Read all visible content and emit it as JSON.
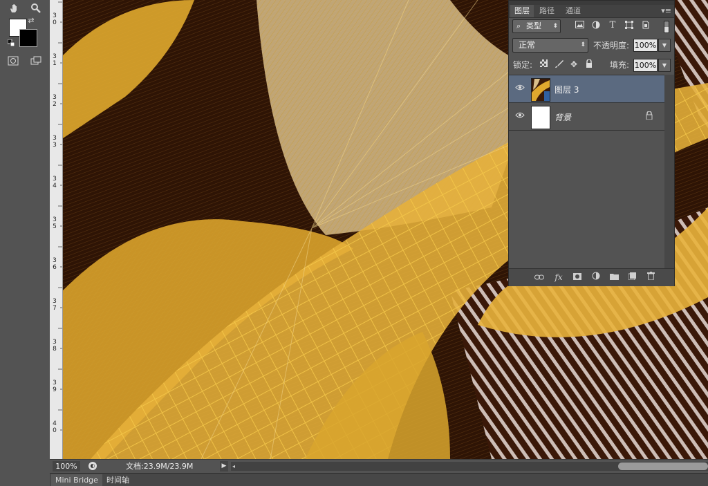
{
  "toolbar": {
    "tools": [
      "hand-icon",
      "zoom-icon",
      "swap-colors-icon",
      "default-colors-icon",
      "quick-mask-icon",
      "screen-mode-icon"
    ]
  },
  "ruler": {
    "labels": [
      {
        "digits": [
          "3",
          "0"
        ]
      },
      {
        "digits": [
          "3",
          "1"
        ]
      },
      {
        "digits": [
          "3",
          "2"
        ]
      },
      {
        "digits": [
          "3",
          "3"
        ]
      },
      {
        "digits": [
          "3",
          "4"
        ]
      },
      {
        "digits": [
          "3",
          "5"
        ]
      },
      {
        "digits": [
          "3",
          "6"
        ]
      },
      {
        "digits": [
          "3",
          "7"
        ]
      },
      {
        "digits": [
          "3",
          "8"
        ]
      },
      {
        "digits": [
          "3",
          "9"
        ]
      },
      {
        "digits": [
          "4",
          "0"
        ]
      }
    ]
  },
  "status": {
    "zoom": "100%",
    "doc_info": "文档:23.9M/23.9M"
  },
  "bottom_tabs": [
    "Mini Bridge",
    "时间轴"
  ],
  "layers_panel": {
    "tabs": [
      "图层",
      "路径",
      "通道"
    ],
    "active_tab": "图层",
    "filter": "类型",
    "blend_mode": "正常",
    "opacity_label": "不透明度:",
    "opacity": "100%",
    "lock_label": "锁定:",
    "fill_label": "填充:",
    "fill": "100%",
    "layers": [
      {
        "name": "图层 3",
        "selected": true,
        "locked": false
      },
      {
        "name": "背景",
        "selected": false,
        "locked": true
      }
    ]
  },
  "colors": {
    "foreground": "#ffffff",
    "background": "#000000",
    "selected_layer": "#5a6a80",
    "canvas_gold": "#e8b43a",
    "canvas_dark": "#2e1405"
  }
}
